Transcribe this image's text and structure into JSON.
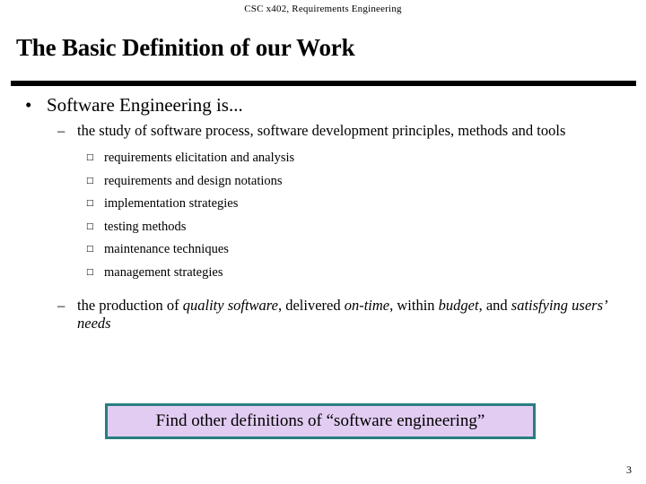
{
  "header": {
    "course_line": "CSC x402, Requirements Engineering"
  },
  "title": {
    "text": "The Basic Definition of our Work"
  },
  "content": {
    "bullet1": {
      "marker": "•",
      "text": "Software Engineering is...",
      "sub_bullets": [
        {
          "marker": "–",
          "text": "the study of software process, software development principles, methods and tools",
          "items": [
            {
              "marker": "□",
              "text": "requirements elicitation and analysis"
            },
            {
              "marker": "□",
              "text": "requirements and design notations"
            },
            {
              "marker": "□",
              "text": "implementation strategies"
            },
            {
              "marker": "□",
              "text": "testing methods"
            },
            {
              "marker": "□",
              "text": "maintenance techniques"
            },
            {
              "marker": "□",
              "text": "management strategies"
            }
          ]
        },
        {
          "marker": "–",
          "segments": [
            {
              "text": "the production of ",
              "italic": false
            },
            {
              "text": "quality software",
              "italic": true
            },
            {
              "text": ", delivered ",
              "italic": false
            },
            {
              "text": "on-time",
              "italic": true
            },
            {
              "text": ", within ",
              "italic": false
            },
            {
              "text": "budget",
              "italic": true
            },
            {
              "text": ", and ",
              "italic": false
            },
            {
              "text": "satisfying users’ needs",
              "italic": true
            }
          ]
        }
      ]
    }
  },
  "callout": {
    "text": "Find other definitions of “software engineering”",
    "fill_color": "#e2ccf2",
    "border_color": "#2a7d80"
  },
  "footer": {
    "page_number": "3"
  }
}
